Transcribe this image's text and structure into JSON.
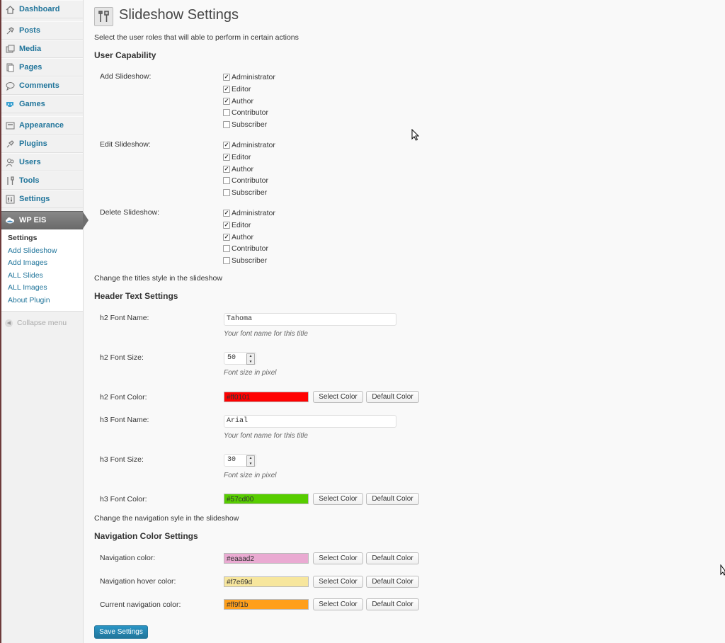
{
  "menu": {
    "items": [
      {
        "key": "dashboard",
        "label": "Dashboard"
      },
      {
        "key": "posts",
        "label": "Posts"
      },
      {
        "key": "media",
        "label": "Media"
      },
      {
        "key": "pages",
        "label": "Pages"
      },
      {
        "key": "comments",
        "label": "Comments"
      },
      {
        "key": "games",
        "label": "Games"
      },
      {
        "key": "appearance",
        "label": "Appearance"
      },
      {
        "key": "plugins",
        "label": "Plugins"
      },
      {
        "key": "users",
        "label": "Users"
      },
      {
        "key": "tools",
        "label": "Tools"
      },
      {
        "key": "settings",
        "label": "Settings"
      },
      {
        "key": "wpeis",
        "label": "WP EIS"
      }
    ],
    "submenu": [
      "Settings",
      "Add Slideshow",
      "Add Images",
      "ALL Slides",
      "ALL Images",
      "About Plugin"
    ],
    "collapse_label": "Collapse menu"
  },
  "page": {
    "title": "Slideshow Settings",
    "roles_desc": "Select the user roles that will able to perform in certain actions",
    "user_capability_heading": "User Capability",
    "capabilities": [
      {
        "label": "Add Slideshow:",
        "roles": [
          {
            "name": "Administrator",
            "checked": true
          },
          {
            "name": "Editor",
            "checked": true
          },
          {
            "name": "Author",
            "checked": true
          },
          {
            "name": "Contributor",
            "checked": false
          },
          {
            "name": "Subscriber",
            "checked": false
          }
        ]
      },
      {
        "label": "Edit Slideshow:",
        "roles": [
          {
            "name": "Administrator",
            "checked": true
          },
          {
            "name": "Editor",
            "checked": true
          },
          {
            "name": "Author",
            "checked": true
          },
          {
            "name": "Contributor",
            "checked": false
          },
          {
            "name": "Subscriber",
            "checked": false
          }
        ]
      },
      {
        "label": "Delete Slideshow:",
        "roles": [
          {
            "name": "Administrator",
            "checked": true
          },
          {
            "name": "Editor",
            "checked": true
          },
          {
            "name": "Author",
            "checked": true
          },
          {
            "name": "Contributor",
            "checked": false
          },
          {
            "name": "Subscriber",
            "checked": false
          }
        ]
      }
    ],
    "titles_desc": "Change the titles style in the slideshow",
    "header_heading": "Header Text Settings",
    "h2_font_name_label": "h2 Font Name:",
    "h2_font_name_value": "Tahoma",
    "font_name_hint": "Your font name for this title",
    "h2_font_size_label": "h2 Font Size:",
    "h2_font_size_value": "50",
    "font_size_hint": "Font size in pixel",
    "h2_font_color_label": "h2 Font Color:",
    "h2_font_color_value": "#ff0101",
    "h3_font_name_label": "h3 Font Name:",
    "h3_font_name_value": "Arial",
    "h3_font_size_label": "h3 Font Size:",
    "h3_font_size_value": "30",
    "h3_font_color_label": "h3 Font Color:",
    "h3_font_color_value": "#57cd00",
    "nav_desc": "Change the navigation syle in the slideshow",
    "nav_heading": "Navigation Color Settings",
    "nav_color_label": "Navigation color:",
    "nav_color_value": "#eaaad2",
    "nav_hover_label": "Navigation hover color:",
    "nav_hover_value": "#f7e69d",
    "nav_current_label": "Current navigation color:",
    "nav_current_value": "#ff9f1b",
    "select_color_label": "Select Color",
    "default_color_label": "Default Color",
    "save_label": "Save Settings"
  },
  "colors": {
    "link": "#21759b",
    "h2_swatch": "#ff0101",
    "h3_swatch": "#57cd00",
    "nav_swatch": "#eaaad2",
    "nav_hover_swatch": "#f7e69d",
    "nav_current_swatch": "#ff9f1b"
  }
}
